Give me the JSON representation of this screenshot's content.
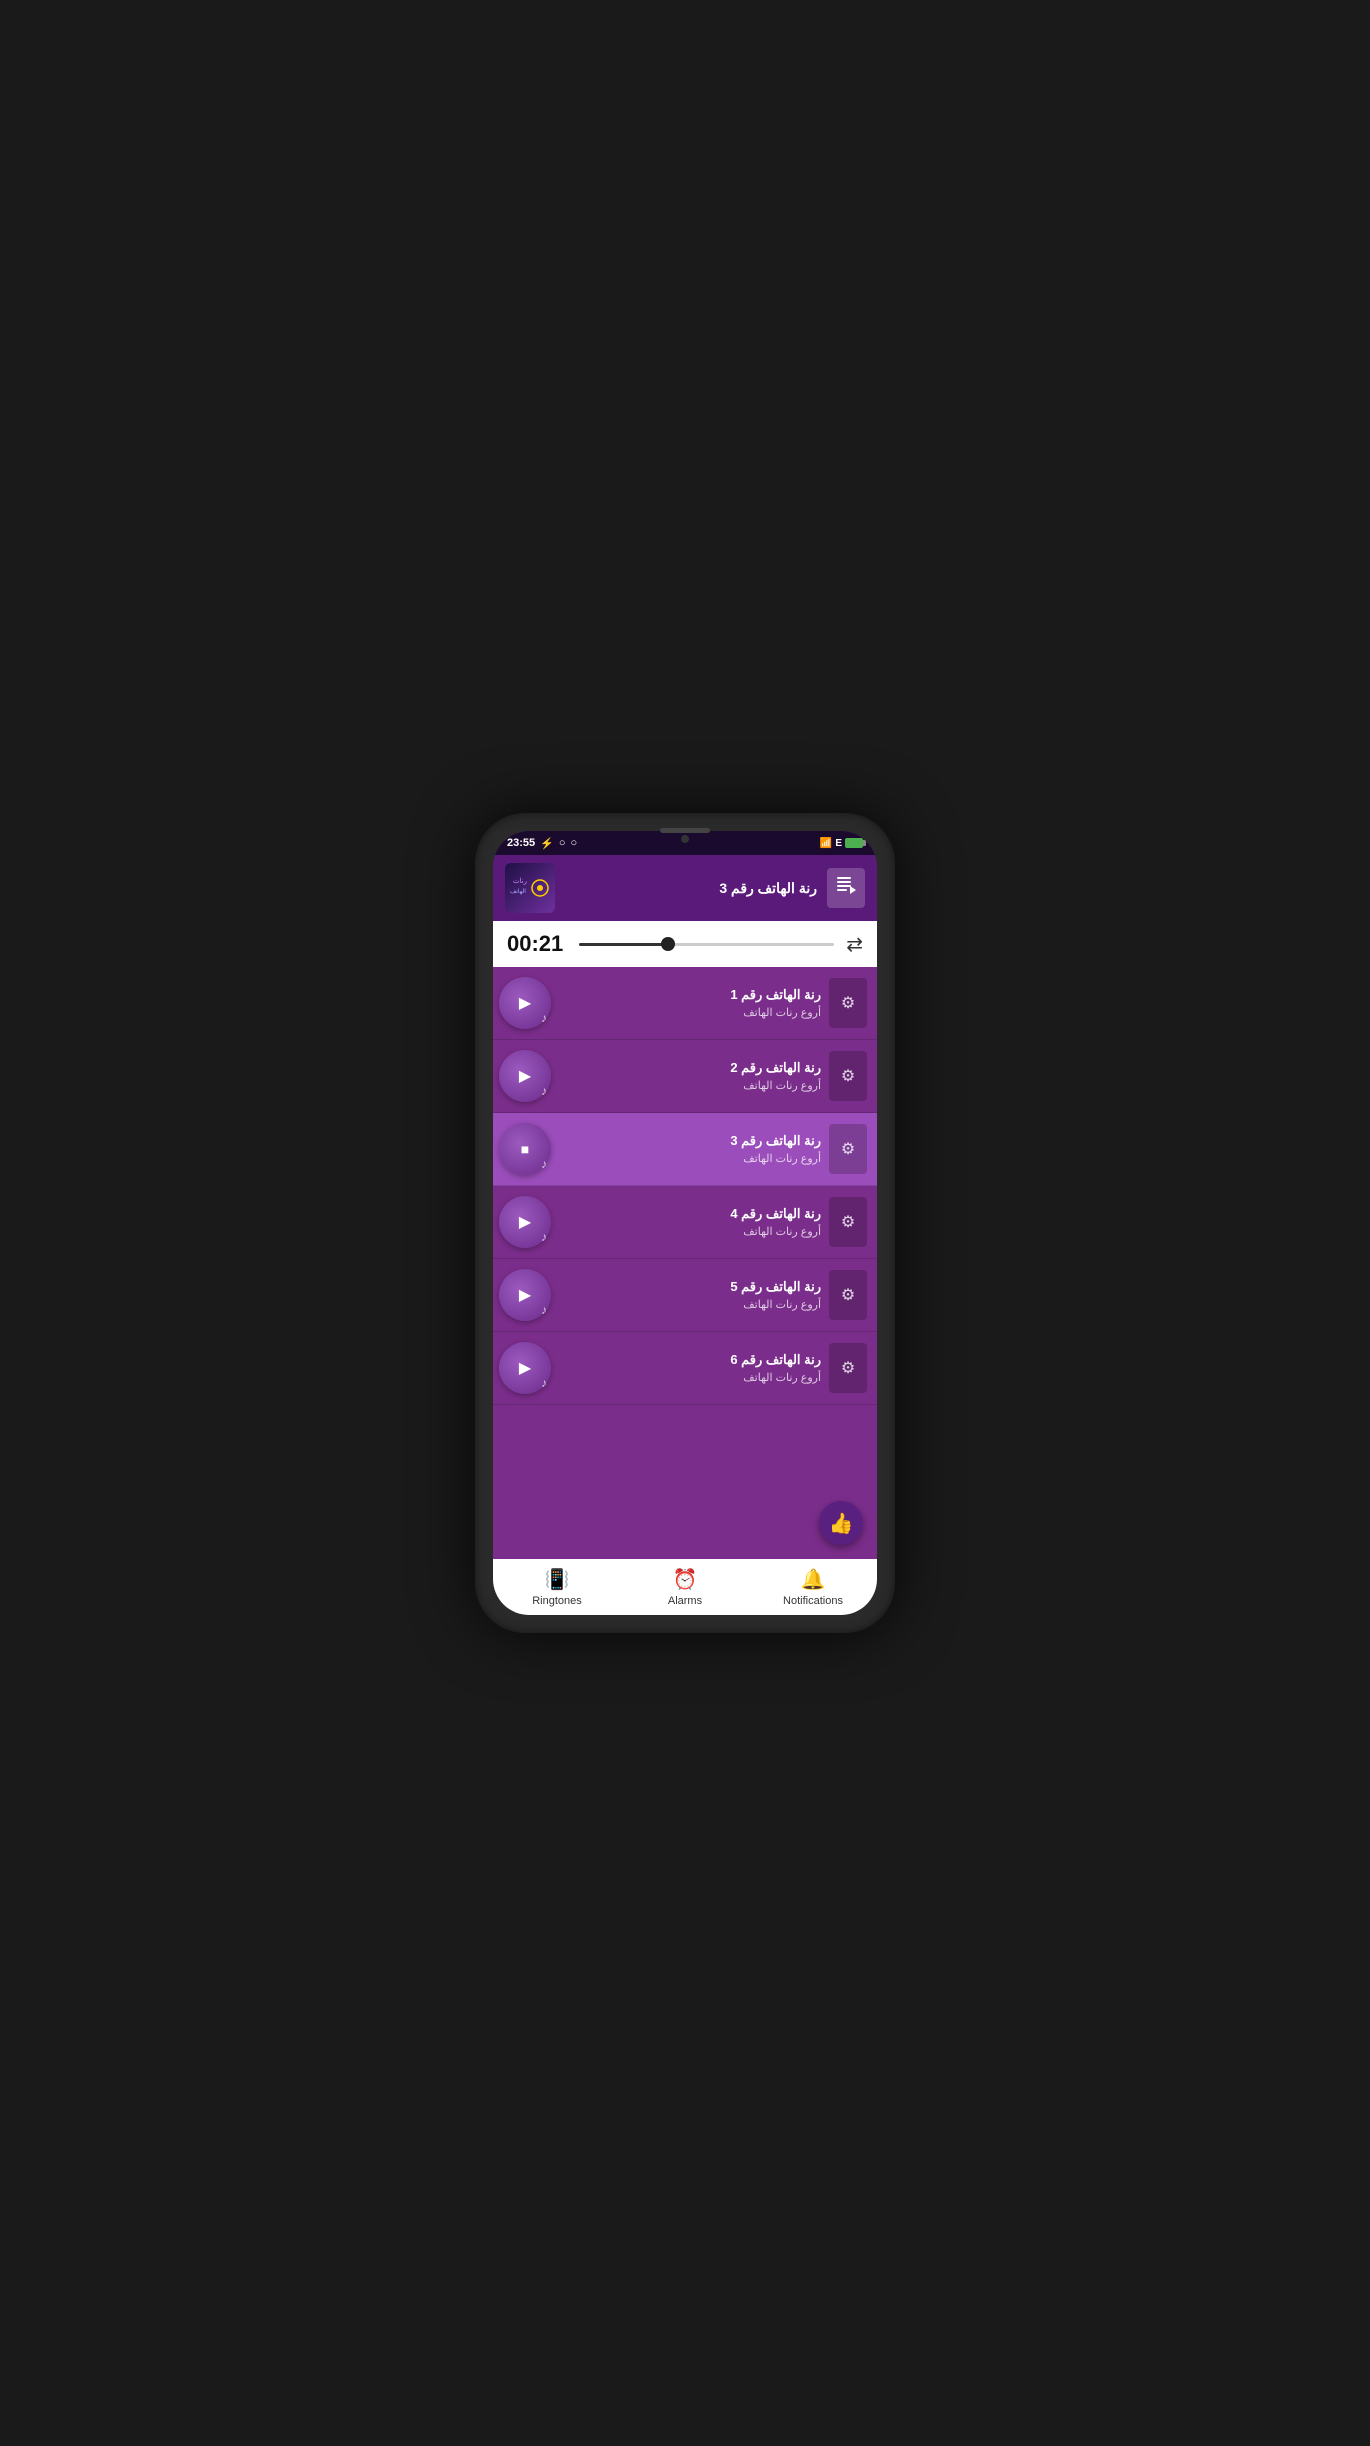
{
  "status": {
    "time": "23:55",
    "signal": "📶",
    "network": "E",
    "battery_icon": "⚡"
  },
  "now_playing": {
    "title": "رنة الهاتف رقم 3",
    "queue_label": "⬛"
  },
  "player": {
    "time": "00:21",
    "progress_percent": 35,
    "repeat_icon": "🔁"
  },
  "songs": [
    {
      "id": 1,
      "title": "رنة الهاتف رقم 1",
      "subtitle": "أروع رنات الهاتف",
      "active": false,
      "playing": false
    },
    {
      "id": 2,
      "title": "رنة الهاتف رقم 2",
      "subtitle": "أروع رنات الهاتف",
      "active": false,
      "playing": false
    },
    {
      "id": 3,
      "title": "رنة الهاتف رقم 3",
      "subtitle": "أروع رنات الهاتف",
      "active": true,
      "playing": true
    },
    {
      "id": 4,
      "title": "رنة الهاتف رقم 4",
      "subtitle": "أروع رنات الهاتف",
      "active": false,
      "playing": false
    },
    {
      "id": 5,
      "title": "رنة الهاتف رقم 5",
      "subtitle": "أروع رنات الهاتف",
      "active": false,
      "playing": false
    },
    {
      "id": 6,
      "title": "رنة الهاتف رقم 6",
      "subtitle": "أروع رنات الهاتف",
      "active": false,
      "playing": false
    }
  ],
  "bottom_nav": {
    "ringtones_label": "Ringtones",
    "alarms_label": "Alarms",
    "notifications_label": "Notifications"
  },
  "fab": {
    "icon": "👍"
  }
}
